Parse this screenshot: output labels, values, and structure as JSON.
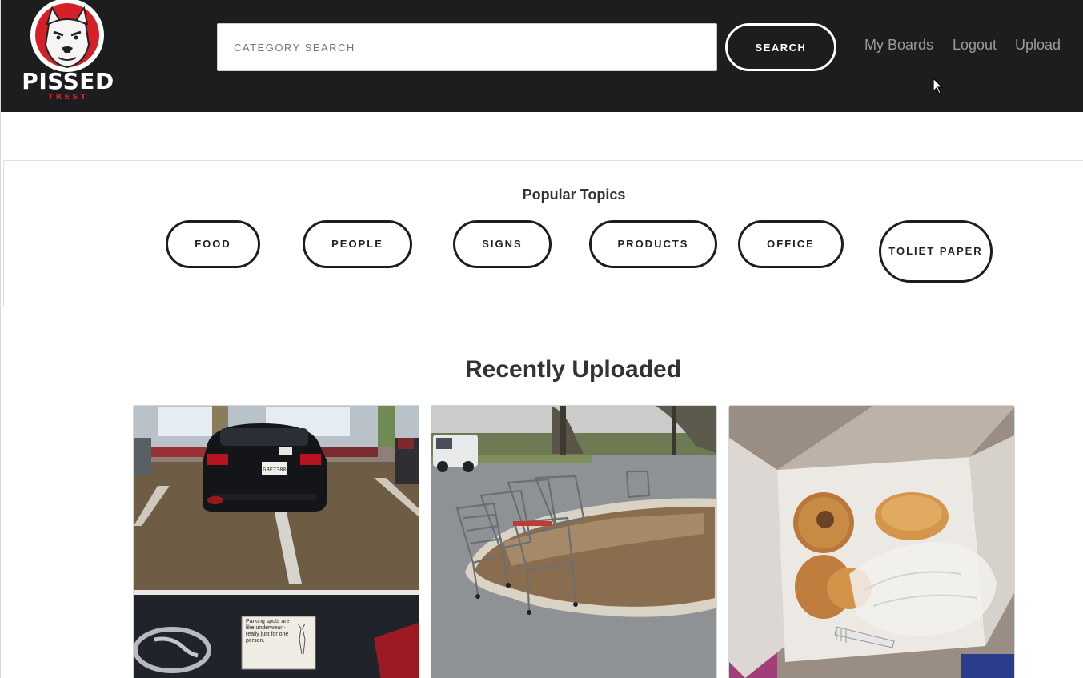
{
  "brand": {
    "logo_word": "PISSED",
    "logo_sub": "TREST"
  },
  "header": {
    "search_placeholder": "CATEGORY SEARCH",
    "search_label": "SEARCH",
    "links": {
      "boards": "My Boards",
      "logout": "Logout",
      "upload": "Upload"
    }
  },
  "topics": {
    "title": "Popular Topics",
    "items": [
      "FOOD",
      "PEOPLE",
      "SIGNS",
      "PRODUCTS",
      "OFFICE",
      "TOLIET PAPER"
    ]
  },
  "recent": {
    "title": "Recently Uploaded",
    "sticker_text": "Parking spots are like underwear - really just for one person.",
    "plate_text": "GBF7380"
  },
  "colors": {
    "header_bg": "#1c1d1f",
    "brand_red": "#d62027",
    "link_gray": "#9a9a9a"
  }
}
